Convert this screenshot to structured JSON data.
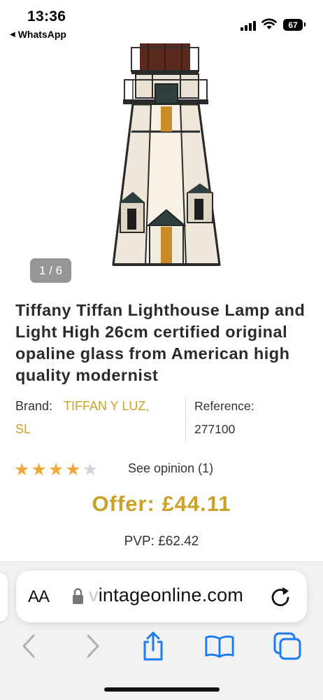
{
  "status_bar": {
    "time": "13:36",
    "back_app": "WhatsApp",
    "battery": "67",
    "icons": [
      "cellular-signal-icon",
      "wifi-icon",
      "battery-icon"
    ]
  },
  "gallery": {
    "counter": "1 / 6",
    "image_subject": "stained-glass lighthouse lamp"
  },
  "product": {
    "title": "Tiffany Tiffan Lighthouse Lamp and Light High 26cm certified original opaline glass from American high quality modernist",
    "brand_label": "Brand:",
    "brand_name_line1": "TIFFAN Y LUZ,",
    "brand_name_line2": "SL",
    "reference_label": "Reference:",
    "reference_value": "277100",
    "rating": 4,
    "rating_max": 5,
    "opinion_link": "See opinion (1)",
    "offer_price": "Offer: £44.11",
    "pvp_price": "PVP: £62.42"
  },
  "browser": {
    "aa_label": "AA",
    "url_faded": "v",
    "url": "intageonline.com",
    "toolbar": [
      "back-icon",
      "forward-icon",
      "share-icon",
      "bookmarks-icon",
      "tabs-icon"
    ]
  },
  "colors": {
    "accent": "#c9a227",
    "star": "#f0a83a",
    "ios_blue": "#1a7cf5"
  }
}
